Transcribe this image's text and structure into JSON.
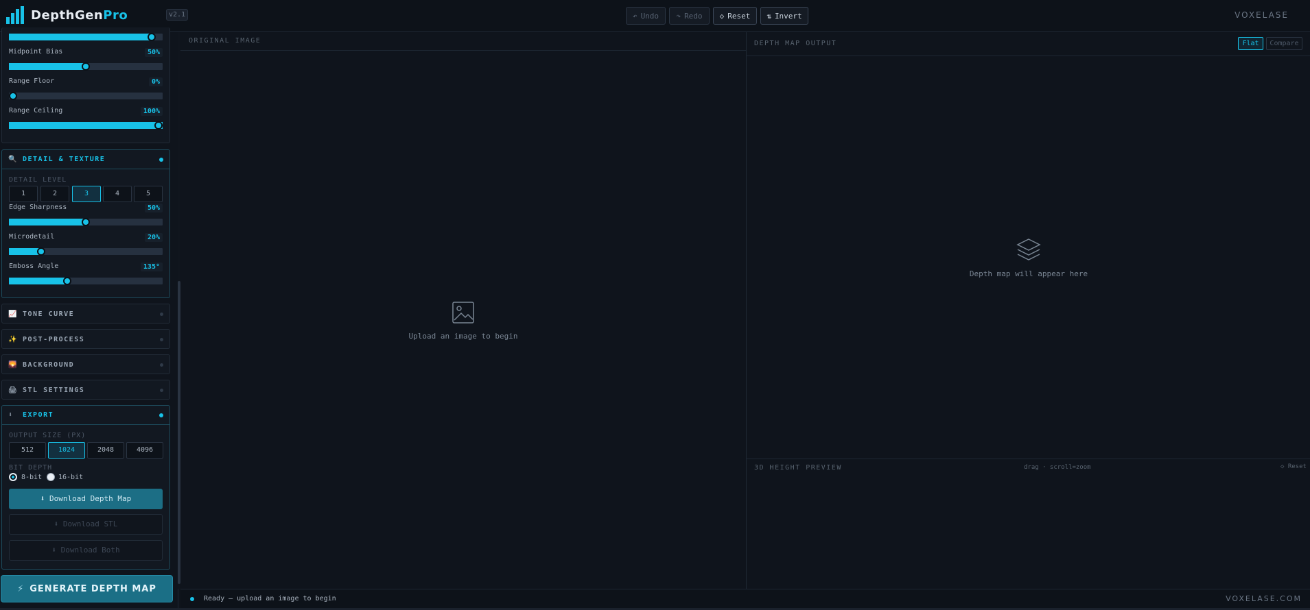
{
  "header": {
    "logo_prefix": "DepthGen",
    "logo_accent": "Pro",
    "version": "v2.1",
    "undo": "Undo",
    "redo": "Redo",
    "reset": "Reset",
    "invert": "Invert",
    "brand": "VOXELASE"
  },
  "depth_range": {
    "midpoint_label": "Midpoint Bias",
    "midpoint_value": "50%",
    "midpoint_pct": 50,
    "floor_label": "Range Floor",
    "floor_value": "0%",
    "floor_pct": 0,
    "ceiling_label": "Range Ceiling",
    "ceiling_value": "100%",
    "ceiling_pct": 100,
    "top_slider_pct": 93
  },
  "detail": {
    "title": "DETAIL & TEXTURE",
    "level_label": "DETAIL LEVEL",
    "levels": [
      "1",
      "2",
      "3",
      "4",
      "5"
    ],
    "selected_level": "3",
    "edge_label": "Edge Sharpness",
    "edge_value": "50%",
    "edge_pct": 50,
    "micro_label": "Microdetail",
    "micro_value": "20%",
    "micro_pct": 21,
    "emboss_label": "Emboss Angle",
    "emboss_value": "135°",
    "emboss_pct": 38
  },
  "sections": {
    "tone_curve": "TONE CURVE",
    "post_process": "POST-PROCESS",
    "background": "BACKGROUND",
    "stl_settings": "STL SETTINGS"
  },
  "export": {
    "title": "EXPORT",
    "size_label": "OUTPUT SIZE (PX)",
    "sizes": [
      "512",
      "1024",
      "2048",
      "4096"
    ],
    "selected_size": "1024",
    "bit_label": "BIT DEPTH",
    "bit8": "8-bit",
    "bit16": "16-bit",
    "download_depth": "Download Depth Map",
    "download_stl": "Download STL",
    "download_both": "Download Both"
  },
  "generate": "GENERATE DEPTH MAP",
  "original": {
    "title": "ORIGINAL IMAGE",
    "placeholder": "Upload an image to begin"
  },
  "depth_output": {
    "title": "DEPTH MAP OUTPUT",
    "flat": "Flat",
    "compare": "Compare",
    "placeholder": "Depth map will appear here"
  },
  "height_preview": {
    "title": "3D HEIGHT PREVIEW",
    "hint": "drag · scroll=zoom",
    "reset": "Reset"
  },
  "status": {
    "text": "Ready — upload an image to begin",
    "brand": "VOXELASE.COM"
  },
  "colors": {
    "accent": "#18c2e8",
    "background": "#0f141c",
    "panel": "#121821"
  }
}
